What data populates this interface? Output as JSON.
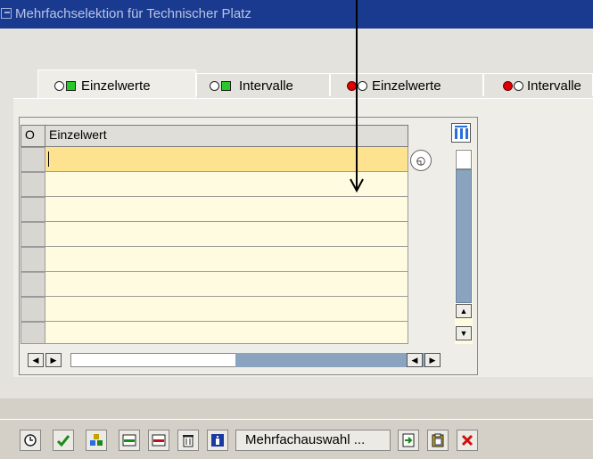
{
  "window": {
    "title": "Mehrfachselektion für Technischer Platz"
  },
  "tabs": [
    {
      "label": "Einzelwerte",
      "kind": "include",
      "active": true
    },
    {
      "label": "Intervalle",
      "kind": "include",
      "active": false
    },
    {
      "label": "Einzelwerte",
      "kind": "exclude",
      "active": false
    },
    {
      "label": "Intervalle",
      "kind": "exclude",
      "active": false
    }
  ],
  "table": {
    "headers": {
      "selection": "O",
      "value": "Einzelwert"
    },
    "rows": [
      "",
      "",
      "",
      "",
      "",
      "",
      "",
      ""
    ],
    "active_row": 0
  },
  "toolbar": {
    "buttons": [
      {
        "name": "execute",
        "icon": "clock-execute-icon",
        "color": "#2a6ed8"
      },
      {
        "name": "check",
        "icon": "checkmark-icon",
        "color": "#1a8a1a"
      },
      {
        "name": "options",
        "icon": "selection-options-icon",
        "color": "#c8a000"
      },
      {
        "name": "insert-row",
        "icon": "insert-row-icon",
        "color": "#1a8a1a"
      },
      {
        "name": "delete-row",
        "icon": "delete-row-icon",
        "color": "#c01010"
      },
      {
        "name": "delete-all",
        "icon": "trash-icon",
        "color": "#222222"
      },
      {
        "name": "info",
        "icon": "info-icon",
        "color": "#1a3aa0"
      }
    ],
    "multiple_selection_label": "Mehrfachauswahl ...",
    "trailing_buttons": [
      {
        "name": "import",
        "icon": "import-from-text-icon",
        "color": "#1a8a1a"
      },
      {
        "name": "paste",
        "icon": "clipboard-paste-icon",
        "color": "#c8a000"
      },
      {
        "name": "cancel",
        "icon": "cancel-x-icon",
        "color": "#d01010"
      }
    ]
  },
  "colors": {
    "title_bar": "#1a3a8f",
    "cell_bg": "#fffbe0",
    "active_cell": "#fde38f",
    "scroll_thumb": "#8aa4c0"
  }
}
